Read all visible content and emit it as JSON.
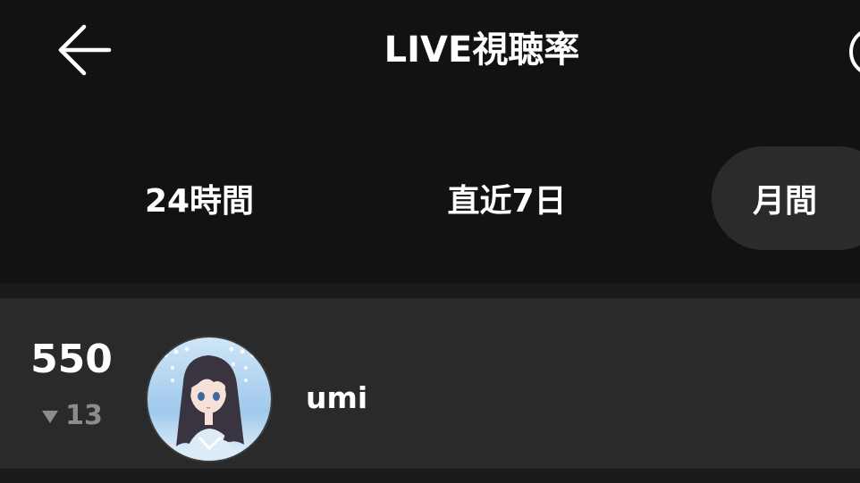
{
  "header": {
    "title": "LIVE視聴率",
    "back_icon": "arrow-left-icon",
    "help_icon": "help-circle-icon"
  },
  "tabs": [
    {
      "label": "24時間",
      "selected": false
    },
    {
      "label": "直近7日",
      "selected": false
    },
    {
      "label": "月間",
      "selected": true
    }
  ],
  "ranking": [
    {
      "rank": "550",
      "change": "13",
      "change_direction": "down",
      "username": "umi",
      "avatar": "anime-girl-avatar"
    }
  ],
  "colors": {
    "background": "#121212",
    "row_background": "#2a2a2a",
    "selected_tab_background": "#2b2b2b",
    "muted_text": "#8c8c8c"
  }
}
